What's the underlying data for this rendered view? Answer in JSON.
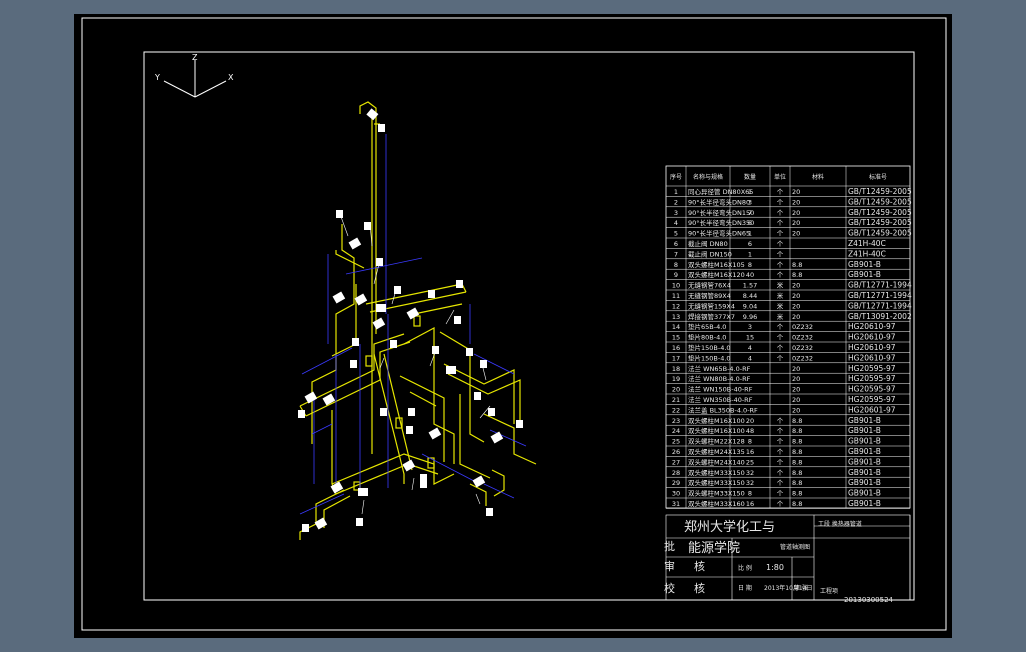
{
  "axes": {
    "z": "Z",
    "y": "Y",
    "x": "X"
  },
  "table": {
    "headers": [
      "序号",
      "名称与规格",
      "数量",
      "单位",
      "材料",
      "标准号"
    ],
    "rows": [
      [
        "1",
        "同心异径管 DN80X65",
        "1",
        "个",
        "20",
        "GB/T12459-2005"
      ],
      [
        "2",
        "90°长半径弯头DN80",
        "3",
        "个",
        "20",
        "GB/T12459-2005"
      ],
      [
        "3",
        "90°长半径弯头DN150",
        "7",
        "个",
        "20",
        "GB/T12459-2005"
      ],
      [
        "4",
        "90°长半径弯头DN350",
        "6",
        "个",
        "20",
        "GB/T12459-2005"
      ],
      [
        "5",
        "90°长半径弯头DN65",
        "1",
        "个",
        "20",
        "GB/T12459-2005"
      ],
      [
        "6",
        "截止阀 DN80",
        "6",
        "个",
        "",
        "Z41H-40C"
      ],
      [
        "7",
        "截止阀 DN150",
        "1",
        "个",
        "",
        "Z41H-40C"
      ],
      [
        "8",
        "双头螺柱M16X105",
        "8",
        "个",
        "8.8",
        "GB901-B"
      ],
      [
        "9",
        "双头螺柱M16X120",
        "40",
        "个",
        "8.8",
        "GB901-B"
      ],
      [
        "10",
        "无缝钢管76X4",
        "1.57",
        "米",
        "20",
        "GB/T12771-1994"
      ],
      [
        "11",
        "无缝钢管89X4",
        "8.44",
        "米",
        "20",
        "GB/T12771-1994"
      ],
      [
        "12",
        "无缝钢管159X4",
        "9.04",
        "米",
        "20",
        "GB/T12771-1994"
      ],
      [
        "13",
        "焊接钢管377X7",
        "9.96",
        "米",
        "20",
        "GB/T13091-2002"
      ],
      [
        "14",
        "垫片65B-4.0",
        "3",
        "个",
        "0Z232",
        "HG20610-97"
      ],
      [
        "15",
        "垫片80B-4.0",
        "15",
        "个",
        "0Z232",
        "HG20610-97"
      ],
      [
        "16",
        "垫片150B-4.0",
        "4",
        "个",
        "0Z232",
        "HG20610-97"
      ],
      [
        "17",
        "垫片150B-4.0",
        "4",
        "个",
        "0Z232",
        "HG20610-97"
      ],
      [
        "18",
        "法兰 WN65B-4.0-RF",
        "",
        "",
        "20",
        "HG20595-97"
      ],
      [
        "19",
        "法兰 WN80B-4.0-RF",
        "",
        "",
        "20",
        "HG20595-97"
      ],
      [
        "20",
        "法兰 WN150B-40-RF",
        "",
        "",
        "20",
        "HG20595-97"
      ],
      [
        "21",
        "法兰 WN350B-40-RF",
        "",
        "",
        "20",
        "HG20595-97"
      ],
      [
        "22",
        "法兰盖 BL350B-4.0-RF",
        "",
        "",
        "20",
        "HG20601-97"
      ],
      [
        "23",
        "双头螺柱M16X100",
        "20",
        "个",
        "8.8",
        "GB901-B"
      ],
      [
        "24",
        "双头螺柱M16X100",
        "48",
        "个",
        "8.8",
        "GB901-B"
      ],
      [
        "25",
        "双头螺柱M22X128",
        "8",
        "个",
        "8.8",
        "GB901-B"
      ],
      [
        "26",
        "双头螺柱M24X135",
        "16",
        "个",
        "8.8",
        "GB901-B"
      ],
      [
        "27",
        "双头螺柱M24X140",
        "25",
        "个",
        "8.8",
        "GB901-B"
      ],
      [
        "28",
        "双头螺柱M33X150",
        "32",
        "个",
        "8.8",
        "GB901-B"
      ],
      [
        "29",
        "双头螺柱M33X150",
        "32",
        "个",
        "8.8",
        "GB901-B"
      ],
      [
        "30",
        "双头螺柱M33X150",
        "8",
        "个",
        "8.8",
        "GB901-B"
      ],
      [
        "31",
        "双头螺柱M33X160",
        "16",
        "个",
        "8.8",
        "GB901-B"
      ]
    ]
  },
  "title_block": {
    "school_line1": "郑州大学化工与",
    "school_line2": "能源学院",
    "drawing_title": "工段  换热器管道",
    "pipe_label": "管道轴测图",
    "approve": "批",
    "review": "审",
    "check": "校",
    "char_he": "核",
    "scale_label": "比 例",
    "scale": "1:80",
    "date_label": "日 期",
    "date": "2013年10月14日",
    "sheet_label": "第 张",
    "design_label": "工程项",
    "drawing_no": "20130300524"
  }
}
